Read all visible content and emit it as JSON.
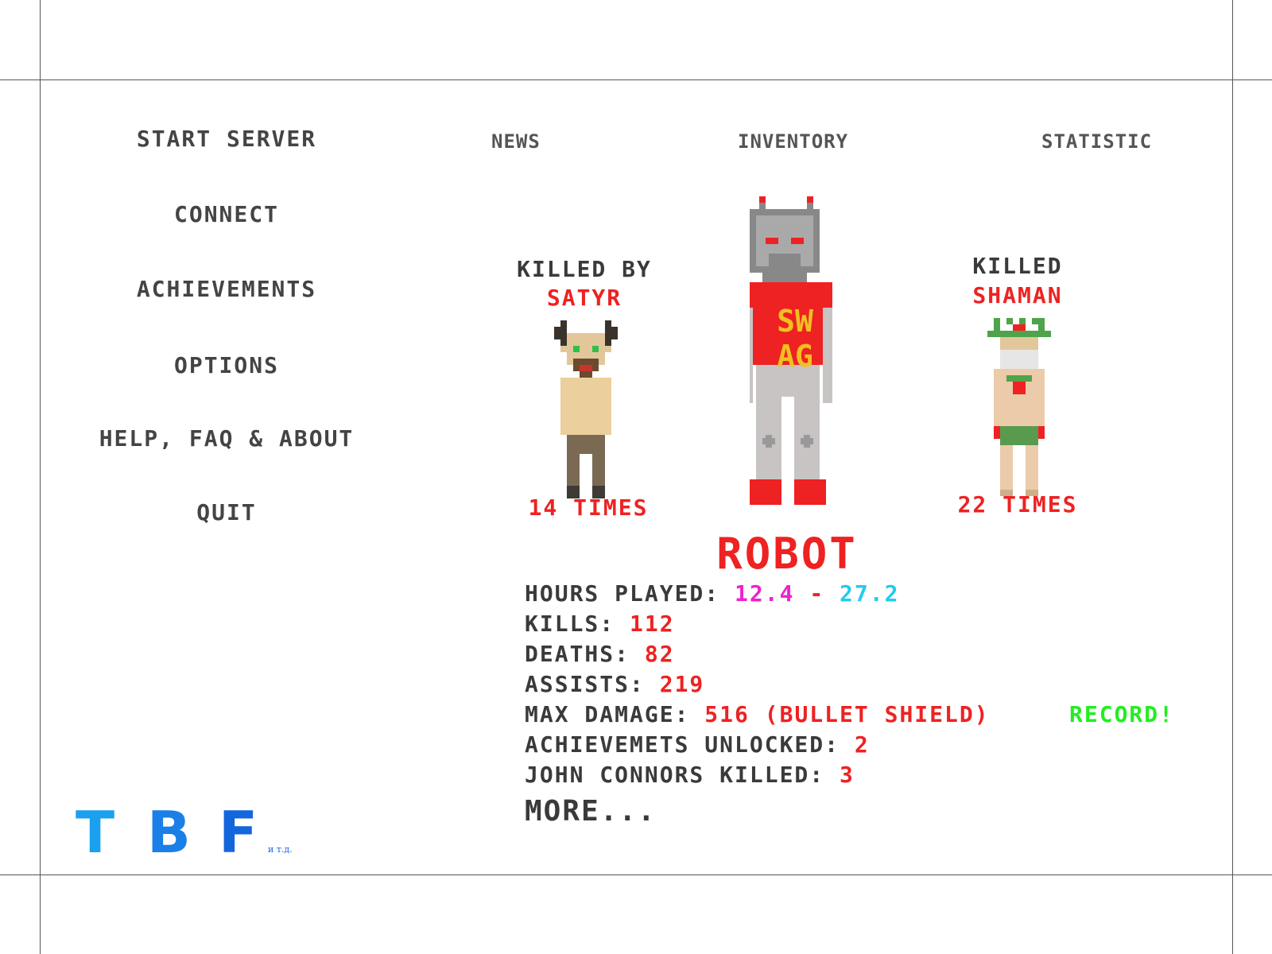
{
  "menu": {
    "items": [
      "START SERVER",
      "CONNECT",
      "ACHIEVEMENTS",
      "OPTIONS",
      "HELP, FAQ & ABOUT",
      "QUIT"
    ]
  },
  "tabs": [
    "NEWS",
    "INVENTORY",
    "STATISTIC"
  ],
  "killed_by": {
    "caption": "KILLED BY",
    "name": "SATYR",
    "count": "14 TIMES"
  },
  "killed": {
    "caption": "KILLED",
    "name": "SHAMAN",
    "count": "22 TIMES"
  },
  "character": {
    "name": "ROBOT",
    "shirt_text": "SW AG"
  },
  "stats": {
    "hours_label": "HOURS PLAYED:",
    "hours_min": "12.4",
    "hours_sep": "-",
    "hours_max": "27.2",
    "kills_label": "KILLS:",
    "kills": "112",
    "deaths_label": "DEATHS:",
    "deaths": "82",
    "assists_label": "ASSISTS:",
    "assists": "219",
    "max_damage_label": "MAX DAMAGE:",
    "max_damage": "516 (BULLET SHIELD)",
    "record": "RECORD!",
    "achievements_label": "ACHIEVEMETS UNLOCKED:",
    "achievements": "2",
    "john_label": "JOHN CONNORS KILLED:",
    "john": "3",
    "more": "MORE..."
  },
  "logo": {
    "letters": [
      "T",
      "B",
      "F"
    ],
    "suffix": "и т.д."
  },
  "colors": {
    "accent_red": "#ee2222",
    "hours_min": "#ee22cc",
    "hours_max": "#22ccee",
    "record": "#22ee22",
    "text_dark": "#3a3a3a",
    "logo_light": "#1aa0ee",
    "logo_dark": "#1466dd"
  }
}
